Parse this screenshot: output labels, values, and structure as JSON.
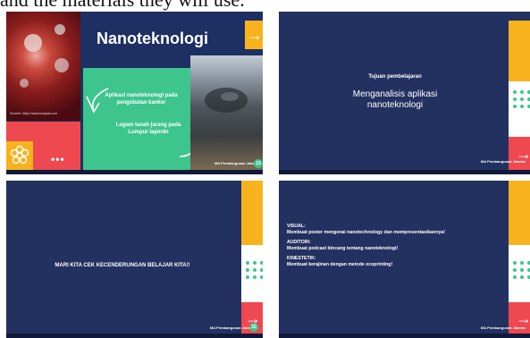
{
  "caption": "and the materials they will use.",
  "slide1": {
    "title": "Nanoteknologi",
    "credit": "Sumber: https://www.kompas.com",
    "callout1": "Aplikasi nanoteknologi pada pengobatan kanker",
    "callout2": "Logam tanah jarang pada Lumpur lapindo",
    "signature": "MA Pembangunan Jakarta",
    "page": "13"
  },
  "slide2": {
    "subtitle": "Tujuan pembelajaran",
    "title": "Menganalisis aplikasi nanoteknologi",
    "signature": "MA Pembangunan Jakarta"
  },
  "slide3": {
    "title": "MARI KITA CEK KECENDERUNGAN BELAJAR KITA!!",
    "signature": "MA Pembangunan Jakarta",
    "page": "15"
  },
  "slide4": {
    "visual_label": "VISUAL:",
    "visual_text": "Membuat poster mengenai nanotechnology dan mempresentasikannya!",
    "auditori_label": "AUDITORI:",
    "auditori_text": "Membuat podcast bincang tentang nanoteknologi!",
    "kinestetik_label": "KINESTETIK:",
    "kinestetik_text": "Membuat kerajinan dengan metode ecoprinting!",
    "signature": "MA Pembangunan Jakarta"
  },
  "colors": {
    "navy": "#22315f",
    "yellow": "#f7b21d",
    "red": "#ee4850",
    "green": "#3ec58e"
  },
  "icons": [
    "arrow-right-icon",
    "flower-icon",
    "more-dots-icon",
    "dots-grid-icon"
  ]
}
